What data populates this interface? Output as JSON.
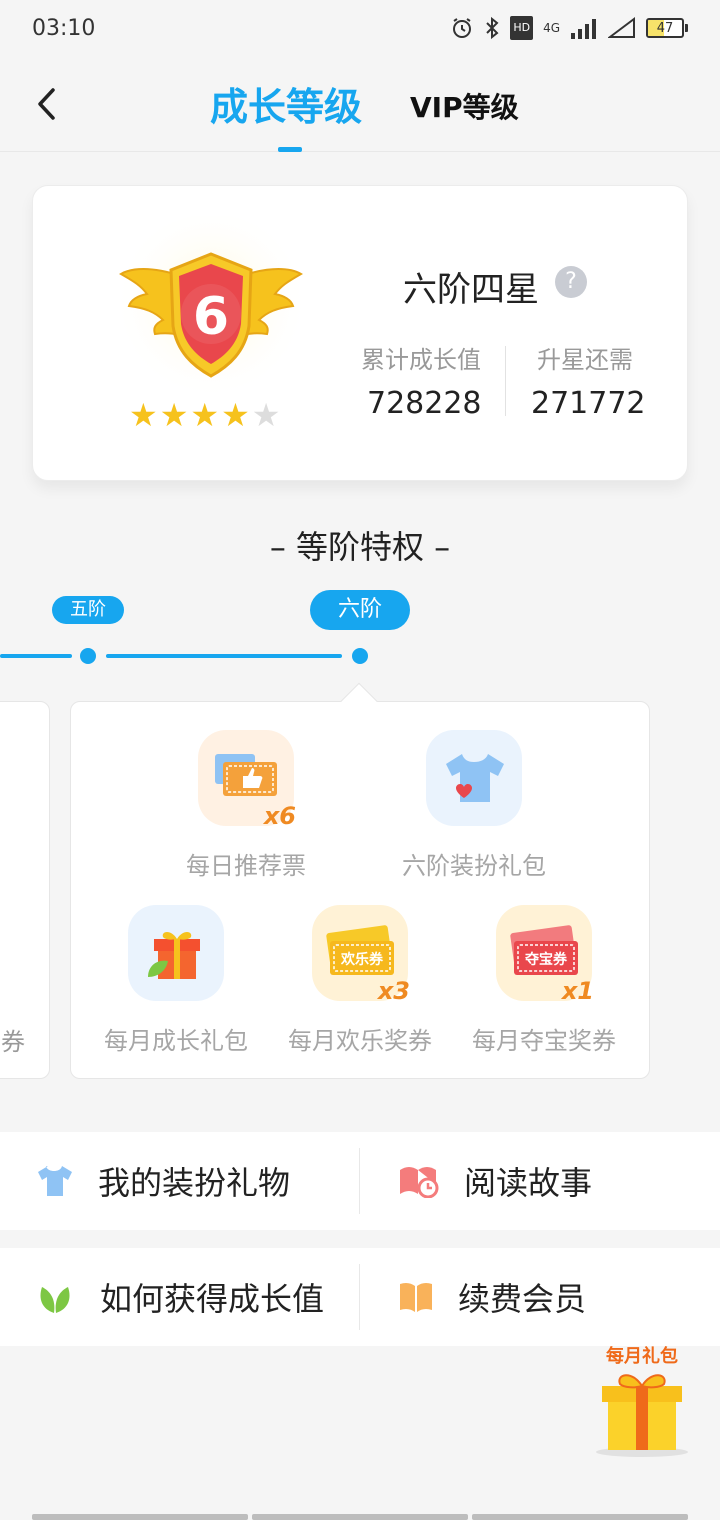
{
  "status_bar": {
    "time": "03:10",
    "hd_label": "HD",
    "network_label": "4G",
    "battery_level": "47",
    "battery_fraction": 0.47
  },
  "nav": {
    "back_icon": "chevron-left-icon",
    "tab_active": "成长等级",
    "tab_vip": "VIP等级"
  },
  "level_card": {
    "badge_number": "6",
    "stars_filled": 4,
    "stars_total": 5,
    "level_name": "六阶四星",
    "help_icon_label": "?",
    "accumulated_label": "累计成长值",
    "accumulated_value": "728228",
    "upgrade_label": "升星还需",
    "upgrade_value": "271772"
  },
  "privileges": {
    "title": "– 等阶特权 –",
    "tier_prev": "五阶",
    "tier_current": "六阶",
    "prev_card_label_fragment": "券",
    "items": [
      {
        "label": "每日推荐票",
        "count": "x6",
        "icon": "recommend-ticket-icon",
        "bg": "#fff1e3"
      },
      {
        "label": "六阶装扮礼包",
        "count": "",
        "icon": "tshirt-heart-icon",
        "bg": "#eaf3fd"
      },
      {
        "label": "每月成长礼包",
        "count": "",
        "icon": "gift-leaf-icon",
        "bg": "#eaf3fd"
      },
      {
        "label": "每月欢乐奖券",
        "count": "x3",
        "icon": "happy-ticket-icon",
        "bg": "#fff2d6"
      },
      {
        "label": "每月夺宝奖券",
        "count": "x1",
        "icon": "treasure-ticket-icon",
        "bg": "#fff2d6"
      }
    ],
    "happy_ticket_text": "欢乐券",
    "treasure_ticket_text": "夺宝券"
  },
  "menu": {
    "row1": [
      {
        "label": "我的装扮礼物",
        "icon": "tshirt-icon"
      },
      {
        "label": "阅读故事",
        "icon": "book-clock-icon"
      }
    ],
    "row2": [
      {
        "label": "如何获得成长值",
        "icon": "leaf-icon"
      },
      {
        "label": "续费会员",
        "icon": "open-book-icon"
      }
    ]
  },
  "floating_gift": {
    "label": "每月礼包",
    "icon": "gift-box-icon"
  },
  "colors": {
    "accent": "#17a6ef",
    "orange": "#ef8a22",
    "gold": "#f6c21d",
    "red": "#e9474c"
  }
}
